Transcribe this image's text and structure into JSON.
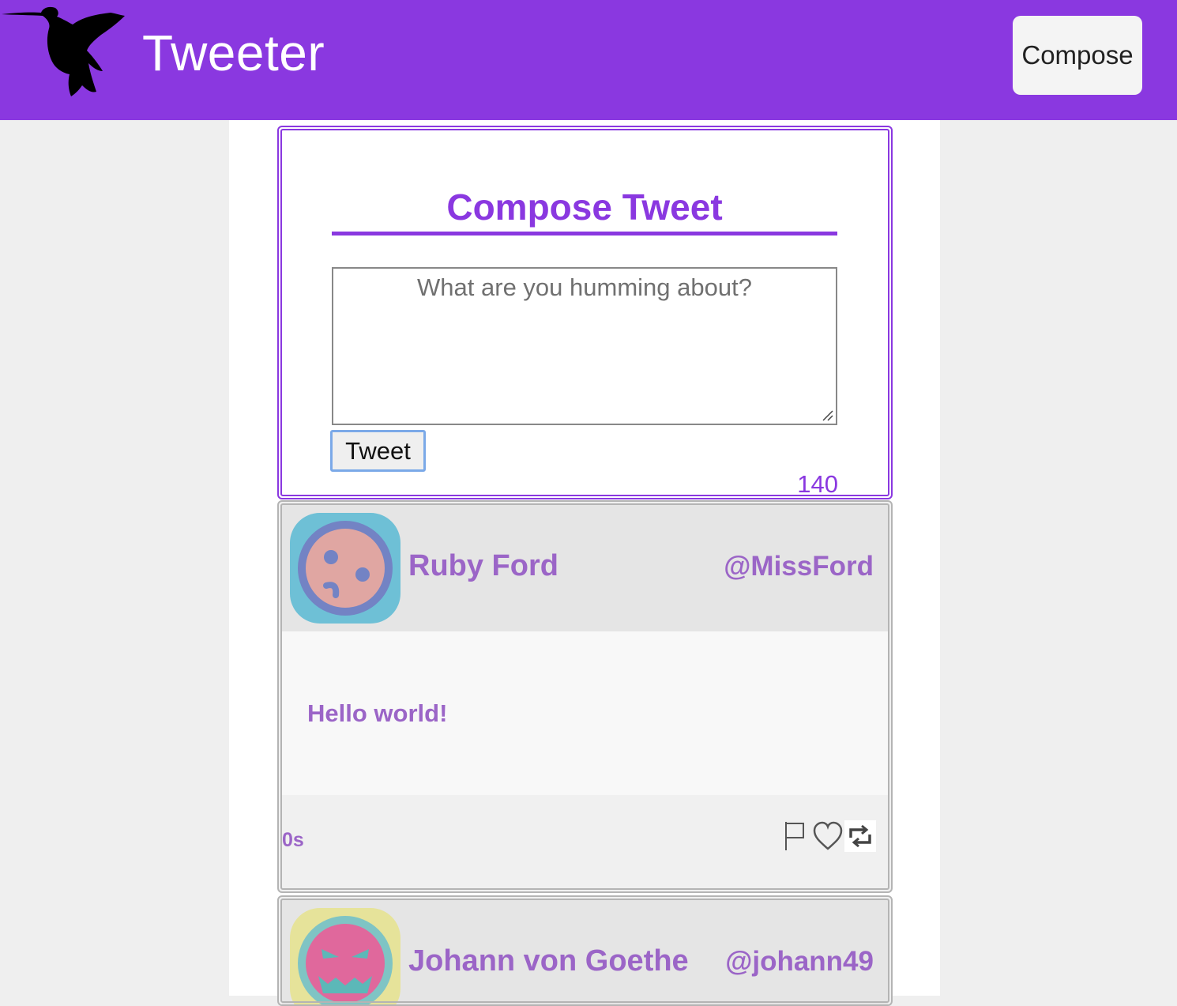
{
  "header": {
    "brand": "Tweeter",
    "compose_label": "Compose",
    "logo_icon": "hummingbird-icon"
  },
  "compose": {
    "title": "Compose Tweet",
    "placeholder": "What are you humming about?",
    "submit_label": "Tweet",
    "counter": "140"
  },
  "tweets": [
    {
      "name": "Ruby Ford",
      "handle": "@MissFord",
      "text": "Hello world!",
      "age": "0s",
      "actions": [
        "flag-icon",
        "heart-icon",
        "retweet-icon"
      ]
    },
    {
      "name": "Johann von Goethe",
      "handle": "@johann49"
    }
  ],
  "colors": {
    "accent": "#8a38e0",
    "tweet_text": "#9b65c7",
    "background": "#efefef"
  }
}
